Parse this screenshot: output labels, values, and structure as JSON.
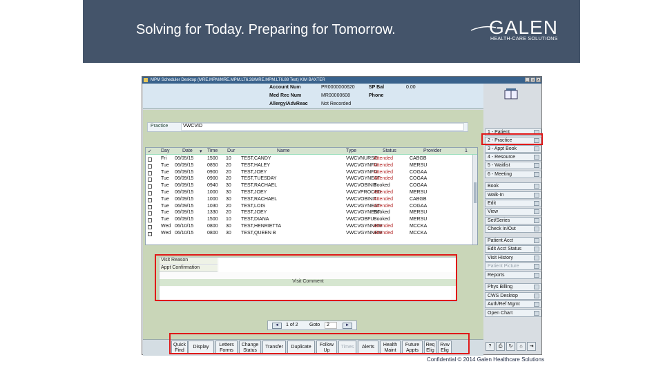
{
  "slide": {
    "tagline": "Solving for Today. Preparing for Tomorrow.",
    "logo_word": "GALEN",
    "logo_sub": "HEALTH-CARE SOLUTIONS",
    "footer": "Confidential © 2014 Galen Healthcare Solutions"
  },
  "window": {
    "title": "MPM Scheduler Desktop   (MRE.MPM/MRE.MPM.LT6.38/MRE.MPM.LT6.88    Test)   KIM BAXTER"
  },
  "patient": {
    "account_num_label": "Account Num",
    "account_num": "PR0000000620",
    "sp_bal_label": "SP Bal",
    "sp_bal": "0.00",
    "med_rec_label": "Med Rec Num",
    "med_rec": "MR00000608",
    "phone_label": "Phone",
    "allergy_label": "Allergy/AdvReac",
    "allergy": "Not Recorded"
  },
  "practice": {
    "label": "Practice",
    "value": "VWCVID"
  },
  "grid": {
    "headers": {
      "day": "Day",
      "date": "Date",
      "time": "Time",
      "dur": "Dur",
      "name": "Name",
      "type": "Type",
      "status": "Status",
      "provider": "Provider",
      "count": "1"
    },
    "rows": [
      {
        "day": "Fri",
        "date": "06/05/15",
        "time": "1500",
        "dur": "10",
        "name": "TEST,CANDY",
        "type": "VWCVNURSE",
        "status": "Attended",
        "provider": "CABGB"
      },
      {
        "day": "Tue",
        "date": "06/09/15",
        "time": "0850",
        "dur": "20",
        "name": "TEST,HALEY",
        "type": "VWCVGYNFU",
        "status": "Attended",
        "provider": "MERSU"
      },
      {
        "day": "Tue",
        "date": "06/09/15",
        "time": "0900",
        "dur": "20",
        "name": "TEST,JOEY",
        "type": "VWCVGYNFU",
        "status": "Attended",
        "provider": "COGAA"
      },
      {
        "day": "Tue",
        "date": "06/09/15",
        "time": "0900",
        "dur": "20",
        "name": "TEST,TUESDAY",
        "type": "VWCVGYNEST",
        "status": "Attended",
        "provider": "COGAA"
      },
      {
        "day": "Tue",
        "date": "06/09/15",
        "time": "0940",
        "dur": "30",
        "name": "TEST,RACHAEL",
        "type": "VWCVOBINIT",
        "status": "Booked",
        "provider": "COGAA"
      },
      {
        "day": "Tue",
        "date": "06/09/15",
        "time": "1000",
        "dur": "30",
        "name": "TEST,JOEY",
        "type": "VWCVPROCED",
        "status": "Attended",
        "provider": "MERSU"
      },
      {
        "day": "Tue",
        "date": "06/09/15",
        "time": "1000",
        "dur": "30",
        "name": "TEST,RACHAEL",
        "type": "VWCVOBINIT",
        "status": "Attended",
        "provider": "CABGB"
      },
      {
        "day": "Tue",
        "date": "06/09/15",
        "time": "1030",
        "dur": "20",
        "name": "TEST,LOIS",
        "type": "VWCVGYNEST",
        "status": "Attended",
        "provider": "COGAA"
      },
      {
        "day": "Tue",
        "date": "06/09/15",
        "time": "1330",
        "dur": "20",
        "name": "TEST,JOEY",
        "type": "VWCVGYNEST",
        "status": "Booked",
        "provider": "MERSU"
      },
      {
        "day": "Tue",
        "date": "06/09/15",
        "time": "1500",
        "dur": "10",
        "name": "TEST,DIANA",
        "type": "VWCVOBFU",
        "status": "Booked",
        "provider": "MERSU"
      },
      {
        "day": "Wed",
        "date": "06/10/15",
        "time": "0800",
        "dur": "30",
        "name": "TEST,HENRIETTA",
        "type": "VWCVGYNNEW",
        "status": "Attended",
        "provider": "MCCKA"
      },
      {
        "day": "Wed",
        "date": "06/10/15",
        "time": "0800",
        "dur": "30",
        "name": "TEST,QUEEN B",
        "type": "VWCVGYNNEW",
        "status": "Attended",
        "provider": "MCCKA"
      }
    ]
  },
  "visit": {
    "reason_label": "Visit Reason",
    "confirm_label": "Appt Confirmation",
    "comment_label": "Visit Comment"
  },
  "pager": {
    "prev": "◄",
    "page": "1 of 2",
    "goto": "Goto",
    "goto_value": "2",
    "next": "►"
  },
  "sidebar": [
    {
      "label": "1 - Patient"
    },
    {
      "label": "2 - Practice"
    },
    {
      "label": "3 - Appt Book"
    },
    {
      "label": "4 - Resource"
    },
    {
      "label": "5 - Waitlist"
    },
    {
      "label": "6 - Meeting"
    },
    {
      "label": "Book"
    },
    {
      "label": "Walk-In"
    },
    {
      "label": "Edit"
    },
    {
      "label": "View"
    },
    {
      "label": "Set/Series"
    },
    {
      "label": "Check In/Out"
    },
    {
      "label": "Patient Acct"
    },
    {
      "label": "Edit Acct Status"
    },
    {
      "label": "Visit History"
    },
    {
      "label": "Patient Picture"
    },
    {
      "label": "Reports"
    },
    {
      "label": "Phys Billing"
    },
    {
      "label": "CWS Desktop"
    },
    {
      "label": "Auth/Ref Mgmt"
    },
    {
      "label": "Open Chart"
    }
  ],
  "toolbar": [
    {
      "l1": "Quick",
      "l2": "Find"
    },
    {
      "l1": "Display",
      "l2": ""
    },
    {
      "l1": "Letters",
      "l2": "Forms"
    },
    {
      "l1": "Change",
      "l2": "Status"
    },
    {
      "l1": "Transfer",
      "l2": ""
    },
    {
      "l1": "Duplicate",
      "l2": ""
    },
    {
      "l1": "Follow",
      "l2": "Up"
    },
    {
      "l1": "Times",
      "l2": ""
    },
    {
      "l1": "Alerts",
      "l2": ""
    },
    {
      "l1": "Health",
      "l2": "Maint"
    },
    {
      "l1": "Future",
      "l2": "Appts"
    },
    {
      "l1": "Req",
      "l2": "Elig"
    },
    {
      "l1": "Rvw",
      "l2": "Elig"
    }
  ],
  "colors": {
    "banner": "#44546a",
    "highlight": "#e01919",
    "attended": "#b22222"
  }
}
